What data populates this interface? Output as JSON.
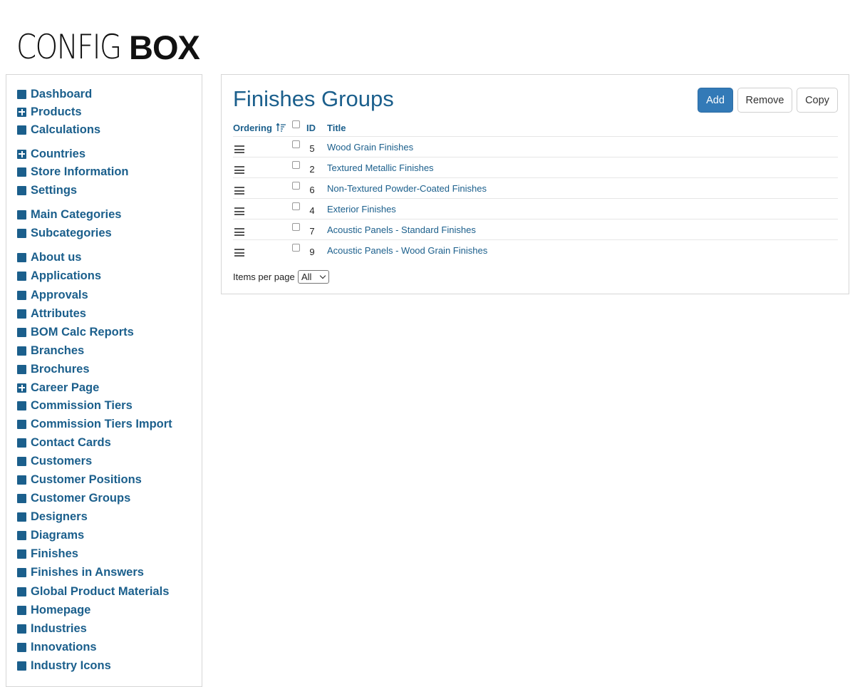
{
  "logo": {
    "light": "CONFIG",
    "bold": "BOX"
  },
  "sidebar": {
    "items": [
      {
        "label": "Dashboard",
        "expandable": false
      },
      {
        "label": "Products",
        "expandable": true
      },
      {
        "label": "Calculations",
        "expandable": false
      },
      {
        "label": "Countries",
        "expandable": true
      },
      {
        "label": "Store Information",
        "expandable": false
      },
      {
        "label": "Settings",
        "expandable": false
      },
      {
        "label": "Main Categories",
        "expandable": false
      },
      {
        "label": "Subcategories",
        "expandable": false
      },
      {
        "label": "About us",
        "expandable": false
      },
      {
        "label": "Applications",
        "expandable": false
      },
      {
        "label": "Approvals",
        "expandable": false
      },
      {
        "label": "Attributes",
        "expandable": false
      },
      {
        "label": "BOM Calc Reports",
        "expandable": false
      },
      {
        "label": "Branches",
        "expandable": false
      },
      {
        "label": "Brochures",
        "expandable": false
      },
      {
        "label": "Career Page",
        "expandable": true
      },
      {
        "label": "Commission Tiers",
        "expandable": false
      },
      {
        "label": "Commission Tiers Import",
        "expandable": false
      },
      {
        "label": "Contact Cards",
        "expandable": false
      },
      {
        "label": "Customers",
        "expandable": false
      },
      {
        "label": "Customer Positions",
        "expandable": false
      },
      {
        "label": "Customer Groups",
        "expandable": false
      },
      {
        "label": "Designers",
        "expandable": false
      },
      {
        "label": "Diagrams",
        "expandable": false
      },
      {
        "label": "Finishes",
        "expandable": false
      },
      {
        "label": "Finishes in Answers",
        "expandable": false
      },
      {
        "label": "Global Product Materials",
        "expandable": false
      },
      {
        "label": "Homepage",
        "expandable": false
      },
      {
        "label": "Industries",
        "expandable": false
      },
      {
        "label": "Innovations",
        "expandable": false
      },
      {
        "label": "Industry Icons",
        "expandable": false
      }
    ]
  },
  "main": {
    "title": "Finishes Groups",
    "buttons": {
      "add": "Add",
      "remove": "Remove",
      "copy": "Copy"
    },
    "table": {
      "headers": {
        "ordering": "Ordering",
        "id": "ID",
        "title": "Title"
      },
      "rows": [
        {
          "id": "5",
          "title": "Wood Grain Finishes"
        },
        {
          "id": "2",
          "title": "Textured Metallic Finishes"
        },
        {
          "id": "6",
          "title": "Non-Textured Powder-Coated Finishes"
        },
        {
          "id": "4",
          "title": "Exterior Finishes"
        },
        {
          "id": "7",
          "title": "Acoustic Panels - Standard Finishes"
        },
        {
          "id": "9",
          "title": "Acoustic Panels - Wood Grain Finishes"
        }
      ]
    },
    "items_per_page": {
      "label": "Items per page",
      "value": "All"
    }
  },
  "colors": {
    "link": "#1b5f8c",
    "primary_button": "#337ab7"
  }
}
